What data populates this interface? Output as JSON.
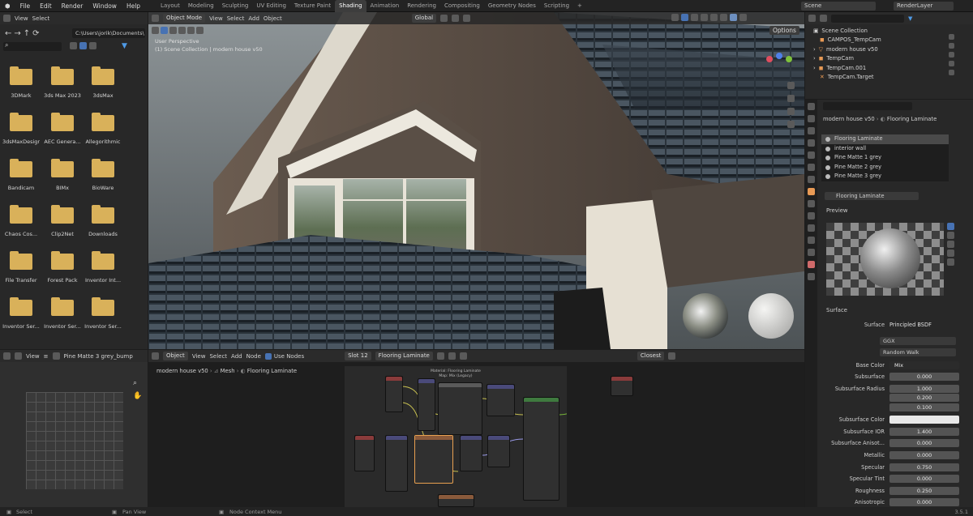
{
  "menu": [
    "File",
    "Edit",
    "Render",
    "Window",
    "Help"
  ],
  "workspaces": [
    "Layout",
    "Modeling",
    "Sculpting",
    "UV Editing",
    "Texture Paint",
    "Shading",
    "Animation",
    "Rendering",
    "Compositing",
    "Geometry Nodes",
    "Scripting"
  ],
  "active_workspace": "Shading",
  "scene_field": "Scene",
  "render_layer_field": "RenderLayer",
  "file_browser": {
    "view": "View",
    "select": "Select",
    "path": "C:\\Users\\jorik\\Documents\\",
    "folders": [
      "3DMark",
      "3ds Max 2023",
      "3dsMax",
      "3dsMaxDesign",
      "AEC Genera...",
      "Allegorithmic",
      "Bandicam",
      "BIMx",
      "BioWare",
      "Chaos Cos...",
      "Clip2Net",
      "Downloads",
      "File Transfer",
      "Forest Pack",
      "Inventor Int...",
      "Inventor Ser...",
      "Inventor Ser...",
      "Inventor Ser..."
    ]
  },
  "viewport": {
    "mode": "Object Mode",
    "view": "View",
    "select": "Select",
    "add": "Add",
    "object": "Object",
    "transform": "Global",
    "options": "Options",
    "perspective": "User Perspective",
    "collection": "(1) Scene Collection | modern house v50"
  },
  "outliner": {
    "root": "Scene Collection",
    "items": [
      "CAMPOS_TempCam",
      "modern house v50",
      "TempCam",
      "TempCam.001",
      "TempCam.Target"
    ]
  },
  "properties": {
    "object": "modern house v50",
    "material": "Flooring Laminate",
    "slots": [
      "Flooring Laminate",
      "interior wall",
      "Pine Matte 1 grey",
      "Pine Matte 2 grey",
      "Pine Matte 3 grey"
    ],
    "material_field": "Flooring Laminate",
    "preview_label": "Preview",
    "surface_label": "Surface",
    "surface_shader": "Principled BSDF",
    "distribution": "GGX",
    "subsurface_method": "Random Walk",
    "rows": [
      {
        "label": "Base Color",
        "value": "Mix",
        "fill": 0
      },
      {
        "label": "Subsurface",
        "value": "0.000",
        "fill": 0
      },
      {
        "label": "Subsurface Radius",
        "value": "1.000",
        "fill": 0
      },
      {
        "label": "",
        "value": "0.200",
        "fill": 0
      },
      {
        "label": "",
        "value": "0.100",
        "fill": 0
      },
      {
        "label": "Subsurface Color",
        "value": "",
        "fill": 0
      },
      {
        "label": "Subsurface IOR",
        "value": "1.400",
        "fill": 0.05
      },
      {
        "label": "Subsurface Anisot...",
        "value": "0.000",
        "fill": 0
      },
      {
        "label": "Metallic",
        "value": "0.000",
        "fill": 0
      },
      {
        "label": "Specular",
        "value": "0.750",
        "fill": 0.75
      },
      {
        "label": "Specular Tint",
        "value": "0.000",
        "fill": 0
      },
      {
        "label": "Roughness",
        "value": "0.250",
        "fill": 0.25
      },
      {
        "label": "Anisotropic",
        "value": "0.000",
        "fill": 0
      }
    ]
  },
  "image_editor": {
    "view": "View",
    "image_name": "Pine Matte 3 grey_bump"
  },
  "node_editor": {
    "type": "Object",
    "view": "View",
    "select": "Select",
    "add": "Add",
    "node": "Node",
    "use_nodes": "Use Nodes",
    "slot": "Slot 12",
    "material": "Flooring Laminate",
    "snap": "Closest",
    "breadcrumb": [
      "modern house v50",
      "Mesh",
      "Flooring Laminate"
    ],
    "frame_title": "Material: Flooring Laminate",
    "frame_subtitle": "Map: Mix (Legacy)"
  },
  "status": {
    "left": "Select",
    "middle": "Pan View",
    "right": "Node Context Menu",
    "version": "3.5.1"
  }
}
